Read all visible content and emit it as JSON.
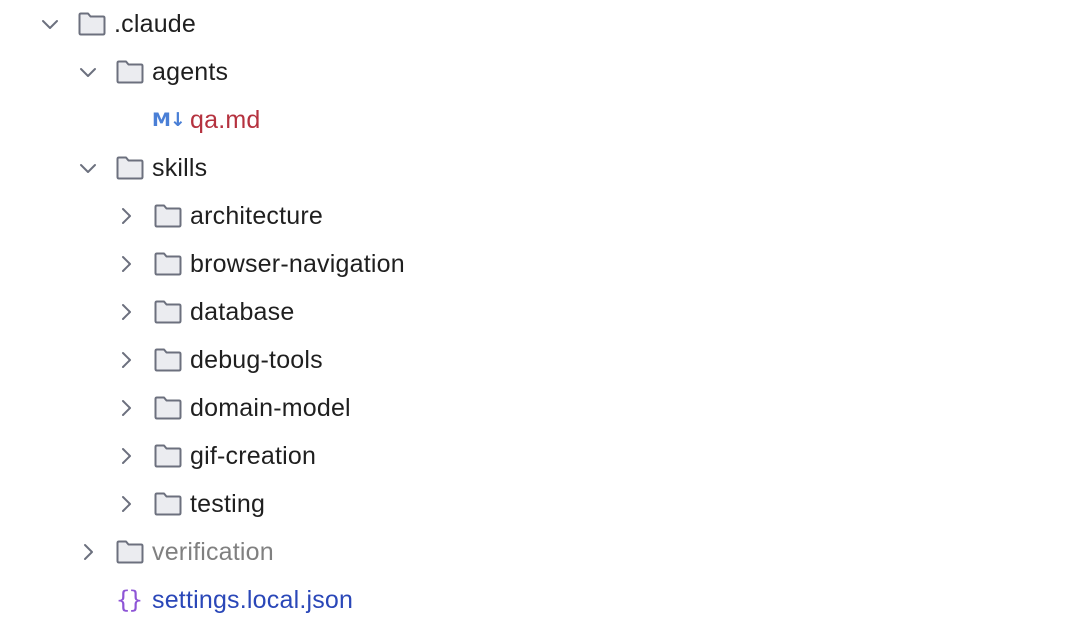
{
  "tree": {
    "root": {
      "label": ".claude",
      "expanded": true,
      "icon": "folder-icon"
    },
    "agents": {
      "label": "agents",
      "expanded": true,
      "icon": "folder-icon"
    },
    "qa_md": {
      "label": "qa.md",
      "icon": "markdown-icon",
      "icon_text": "M↓",
      "status": "modified"
    },
    "skills": {
      "label": "skills",
      "expanded": true,
      "icon": "folder-icon"
    },
    "skill_items": [
      {
        "label": "architecture",
        "expanded": false
      },
      {
        "label": "browser-navigation",
        "expanded": false
      },
      {
        "label": "database",
        "expanded": false
      },
      {
        "label": "debug-tools",
        "expanded": false
      },
      {
        "label": "domain-model",
        "expanded": false
      },
      {
        "label": "gif-creation",
        "expanded": false
      },
      {
        "label": "testing",
        "expanded": false
      }
    ],
    "verification": {
      "label": "verification",
      "expanded": false,
      "status": "excluded"
    },
    "settings": {
      "label": "settings.local.json",
      "icon": "json-icon",
      "icon_text": "{}",
      "status": "added"
    }
  },
  "colors": {
    "text": "#1f1f1f",
    "excluded": "#808080",
    "modified": "#b5323f",
    "added": "#2a47b8",
    "markdown_icon": "#4a7fd6",
    "json_icon": "#8e55d6",
    "folder_stroke": "#6c707e"
  }
}
